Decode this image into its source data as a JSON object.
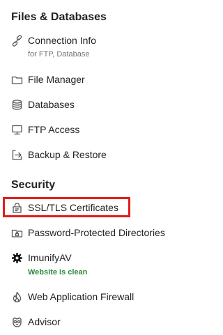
{
  "sections": {
    "files": {
      "title": "Files & Databases",
      "items": [
        {
          "label": "Connection Info",
          "sub": "for FTP, Database",
          "icon": "link-icon"
        },
        {
          "label": "File Manager",
          "icon": "folder-icon"
        },
        {
          "label": "Databases",
          "icon": "database-icon"
        },
        {
          "label": "FTP Access",
          "icon": "ftp-monitor-icon"
        },
        {
          "label": "Backup & Restore",
          "icon": "backup-icon"
        }
      ]
    },
    "security": {
      "title": "Security",
      "items": [
        {
          "label": "SSL/TLS Certificates",
          "icon": "certificate-lock-icon"
        },
        {
          "label": "Password-Protected Directories",
          "icon": "locked-folder-icon"
        },
        {
          "label": "ImunifyAV",
          "sub": "Website is clean",
          "icon": "imunify-gear-icon"
        },
        {
          "label": "Web Application Firewall",
          "icon": "firewall-flame-icon"
        },
        {
          "label": "Advisor",
          "icon": "advisor-owl-icon"
        }
      ]
    }
  },
  "highlight_color": "#e51b1b",
  "status_color": "#2b8a3e"
}
